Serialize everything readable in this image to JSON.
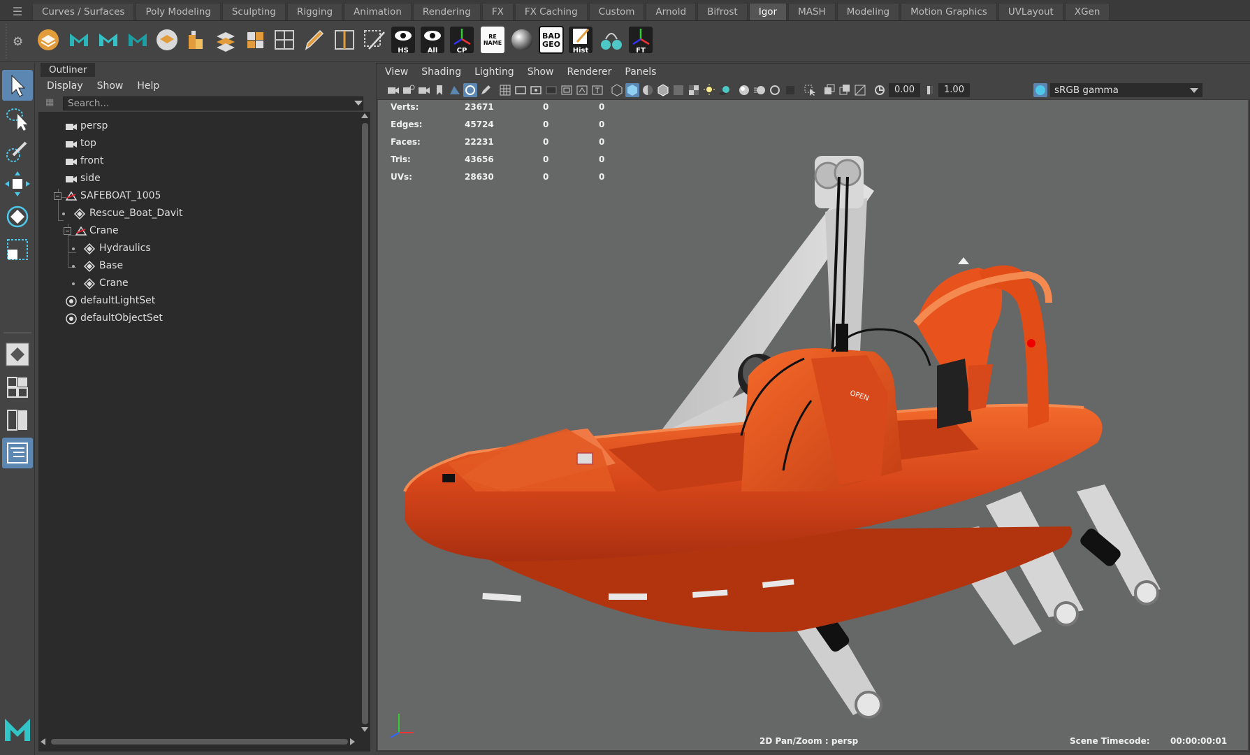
{
  "shelf": {
    "tabs": [
      "Curves / Surfaces",
      "Poly Modeling",
      "Sculpting",
      "Rigging",
      "Animation",
      "Rendering",
      "FX",
      "FX Caching",
      "Custom",
      "Arnold",
      "Bifrost",
      "Igor",
      "MASH",
      "Modeling",
      "Motion Graphics",
      "UVLayout",
      "XGen"
    ],
    "active_tab": "Igor",
    "button_labels": {
      "hs": "HS",
      "all": "All",
      "cp": "CP",
      "rename": "RE NAME",
      "badgeo": "BAD GEO",
      "hist": "Hist",
      "ft": "FT"
    }
  },
  "outliner": {
    "title": "Outliner",
    "menu": [
      "Display",
      "Show",
      "Help"
    ],
    "search_placeholder": "Search...",
    "items": [
      {
        "label": "persp",
        "icon": "camera-icon"
      },
      {
        "label": "top",
        "icon": "camera-icon"
      },
      {
        "label": "front",
        "icon": "camera-icon"
      },
      {
        "label": "side",
        "icon": "camera-icon"
      },
      {
        "label": "SAFEBOAT_1005",
        "icon": "group-icon"
      },
      {
        "label": "Rescue_Boat_Davit",
        "icon": "mesh-icon"
      },
      {
        "label": "Crane",
        "icon": "group-icon"
      },
      {
        "label": "Hydraulics",
        "icon": "mesh-icon"
      },
      {
        "label": "Base",
        "icon": "mesh-icon"
      },
      {
        "label": "Crane",
        "icon": "mesh-icon"
      },
      {
        "label": "defaultLightSet",
        "icon": "set-icon"
      },
      {
        "label": "defaultObjectSet",
        "icon": "set-icon"
      }
    ]
  },
  "viewport": {
    "menu": [
      "View",
      "Shading",
      "Lighting",
      "Show",
      "Renderer",
      "Panels"
    ],
    "exposure": "0.00",
    "gamma": "1.00",
    "color_space": "sRGB gamma",
    "hud": {
      "rows": [
        {
          "label": "Verts:",
          "value": "23671",
          "sel": "0",
          "comp": "0"
        },
        {
          "label": "Edges:",
          "value": "45724",
          "sel": "0",
          "comp": "0"
        },
        {
          "label": "Faces:",
          "value": "22231",
          "sel": "0",
          "comp": "0"
        },
        {
          "label": "Tris:",
          "value": "43656",
          "sel": "0",
          "comp": "0"
        },
        {
          "label": "UVs:",
          "value": "28630",
          "sel": "0",
          "comp": "0"
        }
      ],
      "camera": "2D Pan/Zoom : persp",
      "timecode_label": "Scene Timecode:",
      "timecode": "00:00:00:01"
    },
    "boat_label": "OPEN"
  },
  "colors": {
    "accent": "#5c87b2",
    "boat_orange": "#e8521c",
    "davit_grey": "#cfcfcf",
    "viewport_bg": "#666767"
  }
}
